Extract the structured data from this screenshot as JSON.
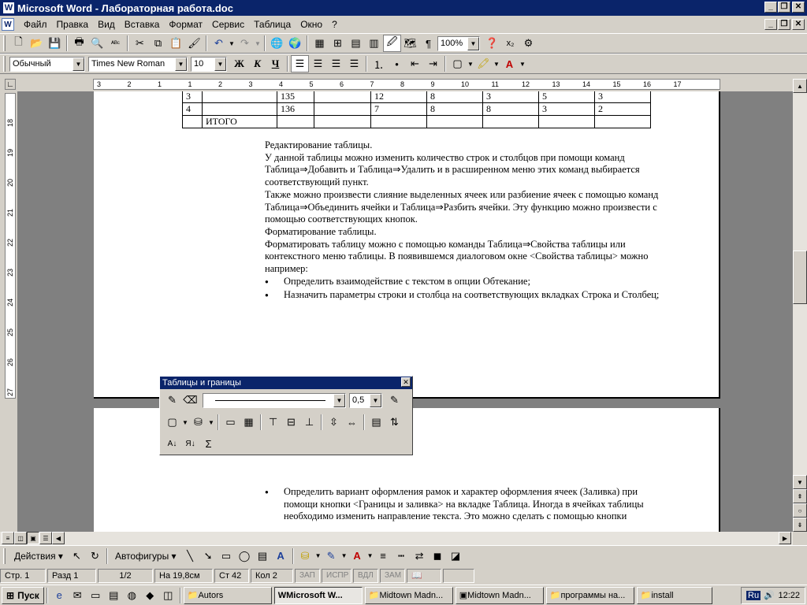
{
  "window": {
    "title": "Microsoft Word - Лабораторная работа.doc",
    "app_icon": "W"
  },
  "menu": [
    "Файл",
    "Правка",
    "Вид",
    "Вставка",
    "Формат",
    "Сервис",
    "Таблица",
    "Окно",
    "?"
  ],
  "formatting": {
    "style": "Обычный",
    "font": "Times New Roman",
    "size": "10",
    "bold": "Ж",
    "italic": "К",
    "underline": "Ч"
  },
  "standard": {
    "zoom": "100%"
  },
  "ruler_h_numbers": [
    "3",
    "2",
    "1",
    "1",
    "2",
    "3",
    "4",
    "5",
    "6",
    "7",
    "8",
    "9",
    "10",
    "11",
    "12",
    "13",
    "14",
    "15",
    "16",
    "17"
  ],
  "ruler_v_numbers": [
    "18",
    "19",
    "20",
    "21",
    "22",
    "23",
    "24",
    "25",
    "26",
    "27"
  ],
  "table": {
    "rows": [
      [
        "3",
        "",
        "135",
        "",
        "12",
        "8",
        "3",
        "5",
        "3"
      ],
      [
        "4",
        "",
        "136",
        "",
        "7",
        "8",
        "8",
        "3",
        "2"
      ],
      [
        "",
        "ИТОГО",
        "",
        "",
        "",
        "",
        "",
        "",
        ""
      ]
    ]
  },
  "doc_lines": [
    "Редактирование таблицы.",
    "У данной таблицы можно изменить количество строк и столбцов при помощи команд",
    "Таблица⇒Добавить и Таблица⇒Удалить и в расширенном меню этих команд выбирается",
    "соответствующий пункт.",
    "Также можно произвести слияние выделенных ячеек или разбиение ячеек с помощью команд",
    "Таблица⇒Объединить ячейки и Таблица⇒Разбить ячейки. Эту функцию можно произвести с",
    "помощью соответствующих кнопок.",
    "Форматирование таблицы.",
    "Форматировать таблицу можно с помощью команды Таблица⇒Свойства таблицы или",
    "контекстного меню таблицы. В появившемся диалоговом окне <Свойства таблицы> можно",
    "например:"
  ],
  "bullets_page1": [
    "Определить взаимодействие с текстом в опции Обтекание;",
    "Назначить параметры строки и столбца на соответствующих вкладках Строка и Столбец;"
  ],
  "bullet_page2": [
    "Определить вариант оформления рамок и характер оформления ячеек (Заливка) при",
    "помощи кнопки <Границы и заливка> на вкладке Таблица. Иногда в ячейках таблицы",
    "необходимо изменить направление текста. Это можно сделать с помощью кнопки"
  ],
  "float_toolbar": {
    "title": "Таблицы и границы",
    "line_width": "0,5"
  },
  "drawing": {
    "actions": "Действия",
    "autoshapes": "Автофигуры"
  },
  "status": {
    "page": "Стр. 1",
    "section": "Разд 1",
    "pages": "1/2",
    "at": "На 19,8см",
    "line": "Ст 42",
    "col": "Кол 2",
    "rec": "ЗАП",
    "trk": "ИСПР",
    "ext": "ВДЛ",
    "ovr": "ЗАМ"
  },
  "taskbar": {
    "start": "Пуск",
    "tasks": [
      "Autors",
      "Microsoft W...",
      "Midtown Madn...",
      "Midtown Madn...",
      "программы на...",
      "install"
    ],
    "lang": "Ru",
    "clock": "12:22"
  }
}
